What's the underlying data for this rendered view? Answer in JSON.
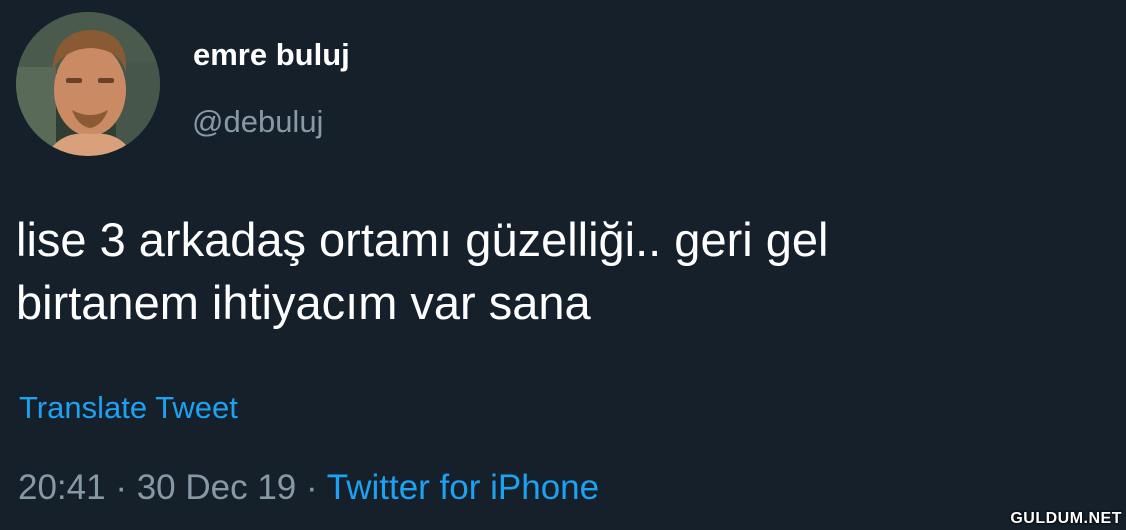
{
  "tweet": {
    "display_name": "emre buluj",
    "handle": "@debuluj",
    "text_line1": "lise 3 arkadaş ortamı güzelliği.. geri gel",
    "text_line2": "birtanem ihtiyacım var sana",
    "translate_label": "Translate Tweet",
    "time": "20:41",
    "separator": " · ",
    "date": "30 Dec 19",
    "source": "Twitter for iPhone"
  },
  "watermark": "GULDUM.NET",
  "colors": {
    "background": "#15202b",
    "text_primary": "#ffffff",
    "text_secondary": "#8899a6",
    "link": "#1da1f2"
  }
}
